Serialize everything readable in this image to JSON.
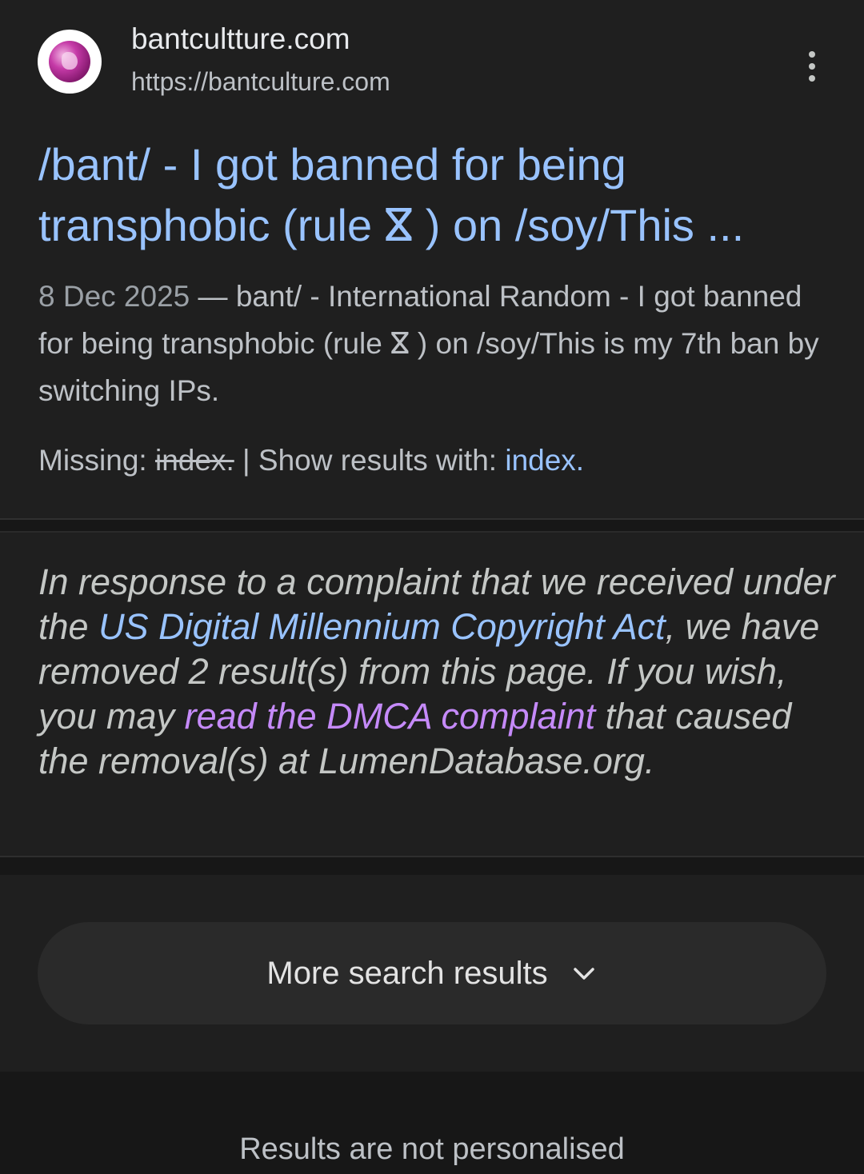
{
  "result": {
    "site_name": "bantcultture.com",
    "site_url": "https://bantculture.com",
    "title": "/bant/ - I got banned for being transphobic (rule ⴵ ) on /soy/This ...",
    "snippet_date": "8 Dec 2025",
    "snippet_separator": " — ",
    "snippet_text": "bant/ - International Random - I got banned for being transphobic (rule ⴵ ) on /soy/This is my 7th ban by switching IPs.",
    "missing_label": "Missing: ",
    "missing_term": "index.",
    "missing_separator": " | Show results with: ",
    "show_with_term": "index.",
    "favicon_icon": "site-favicon-icon"
  },
  "dmca": {
    "text_1": "In response to a complaint that we received under the ",
    "link_1": "US Digital Millennium Copyright Act",
    "text_2": ", we have removed 2 result(s) from this page. If you wish, you may ",
    "link_2": "read the DMCA complaint",
    "text_3": " that caused the removal(s) at LumenDatabase.org."
  },
  "more": {
    "label": "More search results",
    "icon": "chevron-down-icon"
  },
  "footer": {
    "note": "Results are not personalised"
  },
  "colors": {
    "background": "#1f1f1f",
    "link_blue": "#99c3ff",
    "visited_purple": "#c58af9",
    "text_secondary": "#bdc1c6"
  }
}
